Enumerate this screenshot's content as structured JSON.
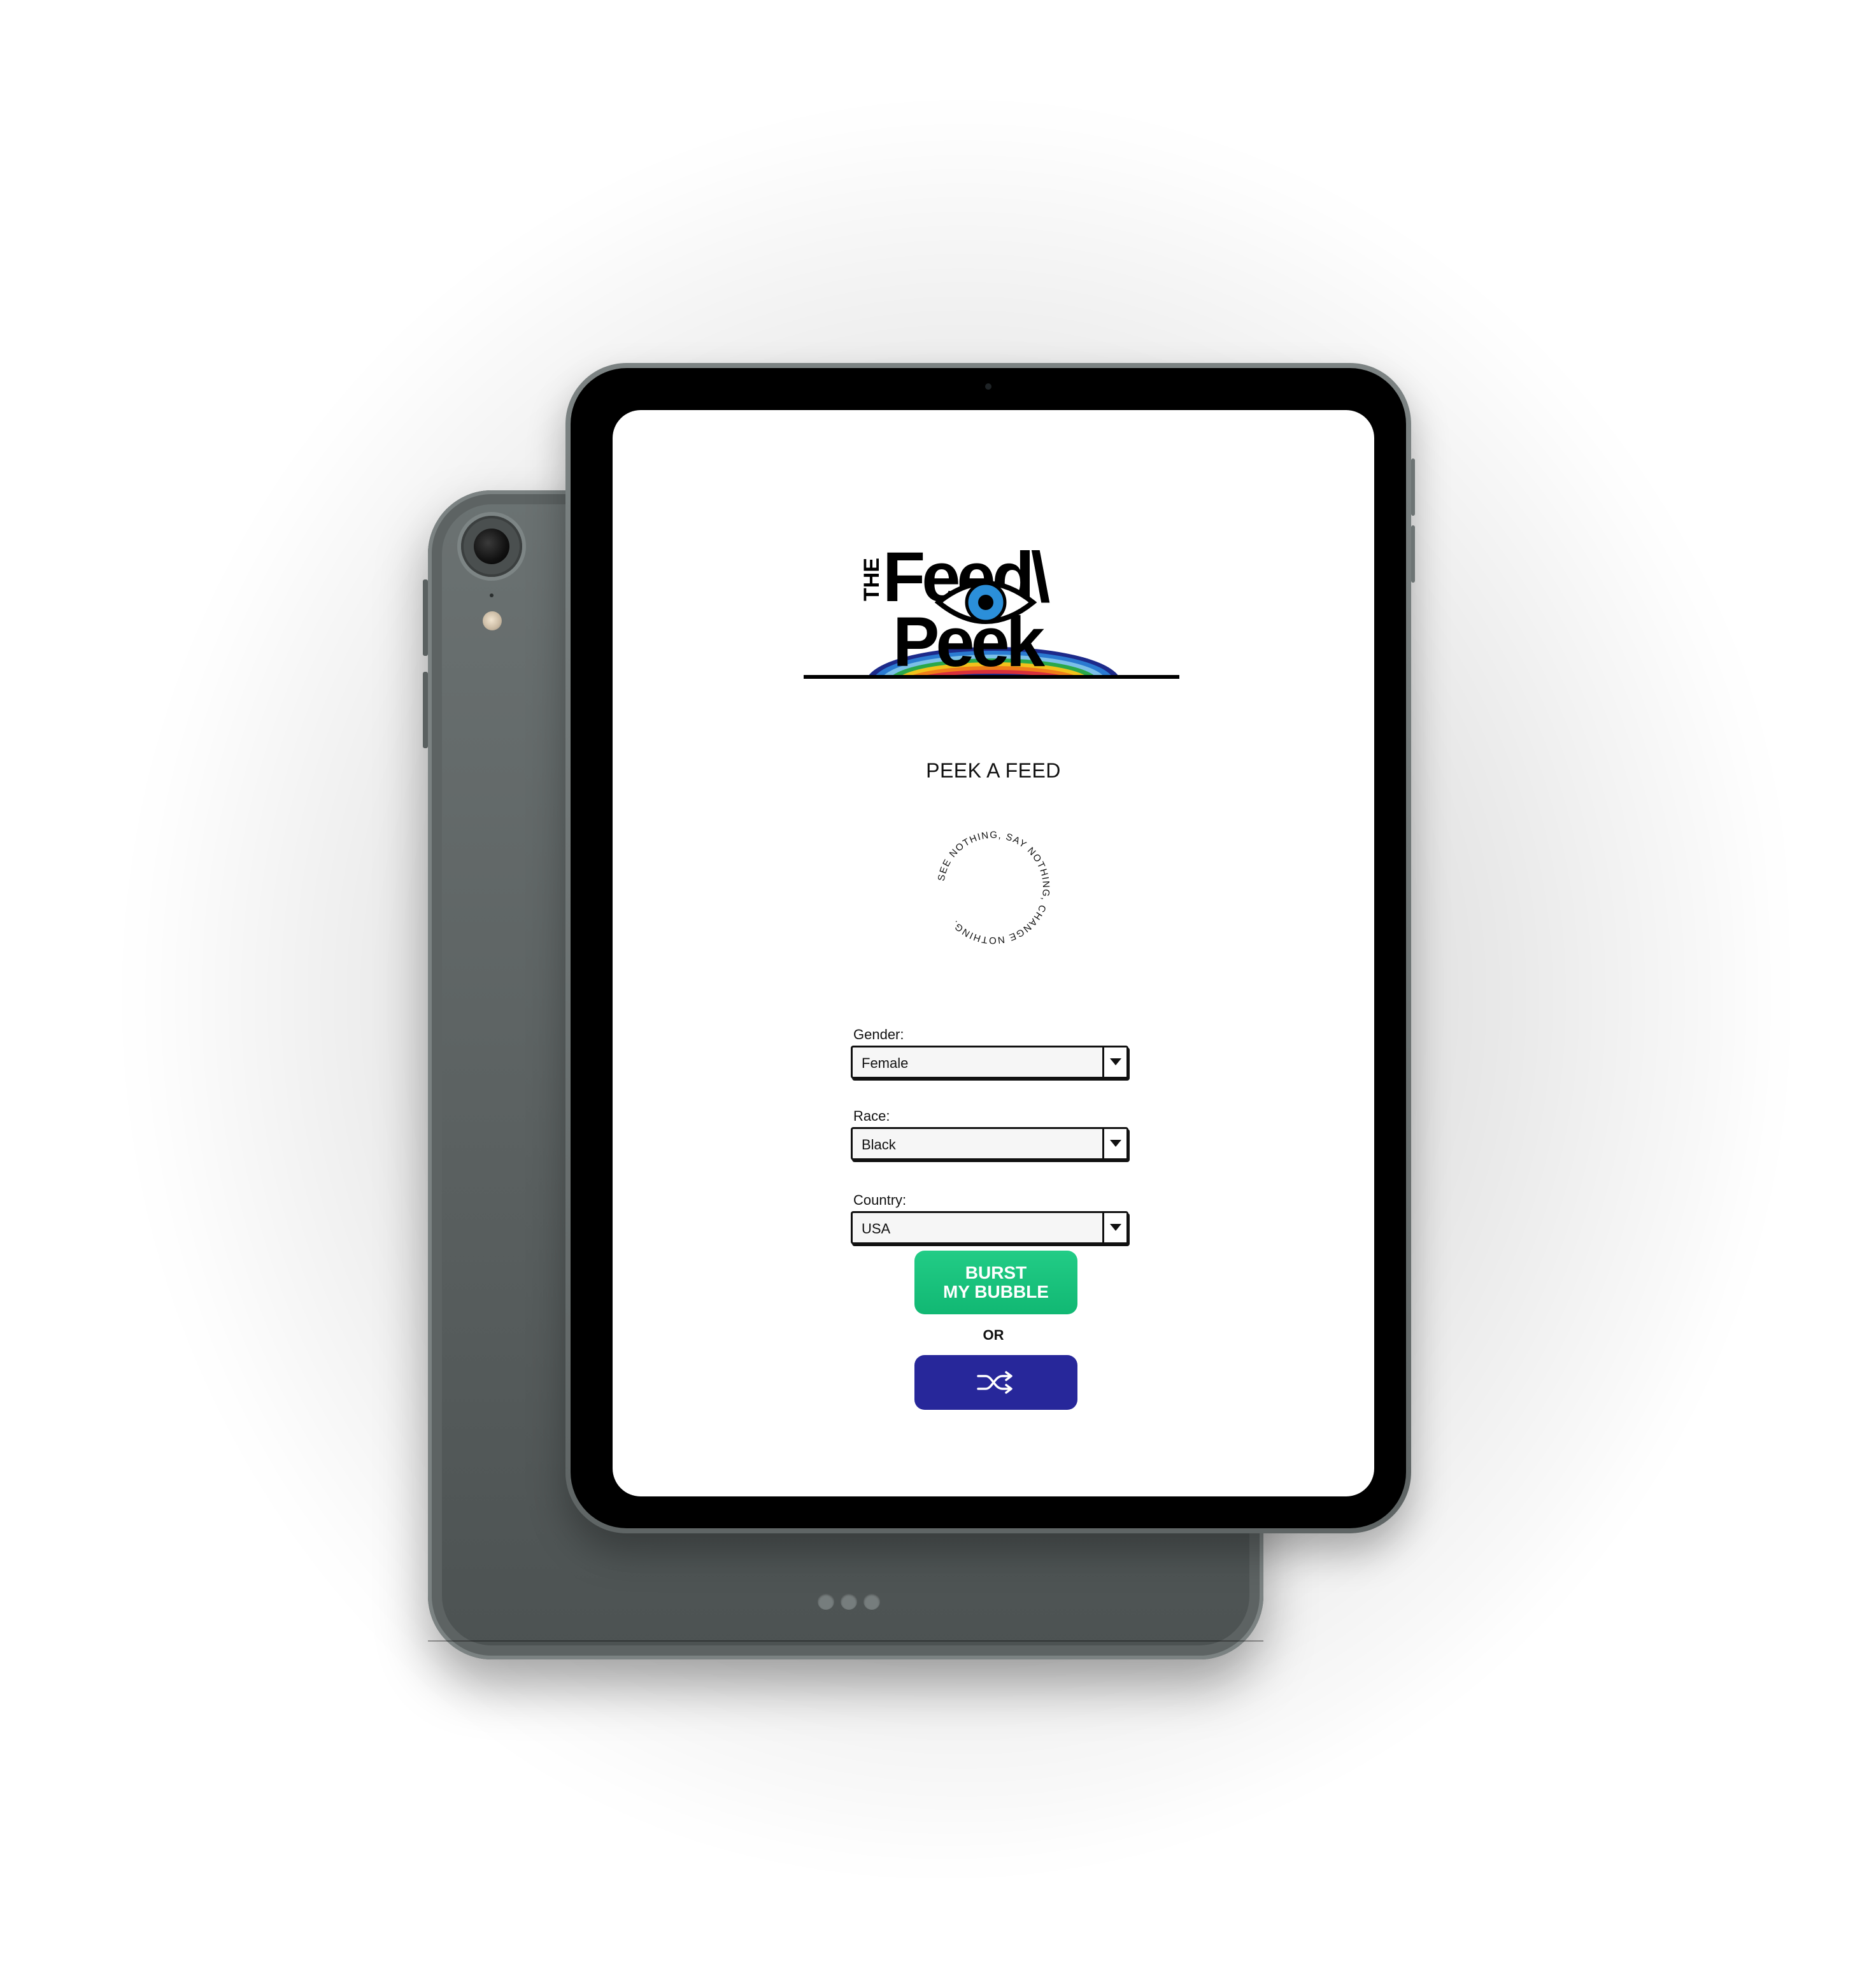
{
  "app": {
    "logo": {
      "top_word": "THE",
      "line1": "Feed\\",
      "line2": "Peek"
    },
    "title": "PEEK A FEED",
    "badge_text": "SEE NOTHING, SAY NOTHING, CHANGE NOTHING.",
    "form": {
      "gender": {
        "label": "Gender:",
        "value": "Female"
      },
      "race": {
        "label": "Race:",
        "value": "Black"
      },
      "country": {
        "label": "Country:",
        "value": "USA"
      }
    },
    "burst_button": {
      "line1": "BURST",
      "line2": "MY BUBBLE"
    },
    "or_text": "OR",
    "shuffle_icon": "shuffle-icon"
  },
  "colors": {
    "burst_green": "#16c07a",
    "shuffle_blue": "#27279a",
    "eye_blue": "#2b8fd9",
    "device_gray": "#5f6565"
  }
}
